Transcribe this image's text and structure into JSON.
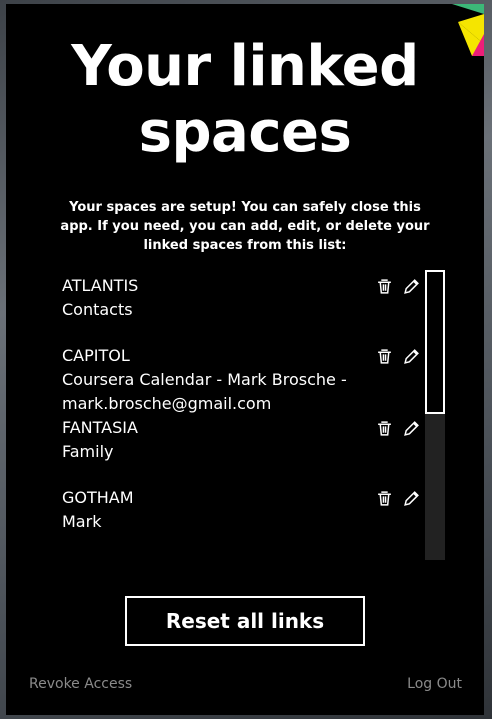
{
  "title_line1": "Your linked",
  "title_line2": "spaces",
  "subtitle": "Your spaces are setup! You can safely close this app. If you need, you can add, edit, or delete your linked spaces from this list:",
  "spaces": [
    {
      "name": "ATLANTIS",
      "description": "Contacts"
    },
    {
      "name": "CAPITOL",
      "description": "Coursera Calendar - Mark Brosche - mark.brosche@gmail.com"
    },
    {
      "name": "FANTASIA",
      "description": "Family"
    },
    {
      "name": "GOTHAM",
      "description": "Mark"
    }
  ],
  "icons": {
    "delete": "trash-icon",
    "edit": "pencil-icon"
  },
  "reset_button": "Reset all links",
  "footer": {
    "revoke": "Revoke Access",
    "logout": "Log Out"
  },
  "colors": {
    "background": "#000000",
    "text": "#ffffff",
    "muted": "#8a8a8a",
    "logo_yellow": "#f5e500",
    "logo_green": "#3cb878",
    "logo_pink": "#ec1e79"
  }
}
